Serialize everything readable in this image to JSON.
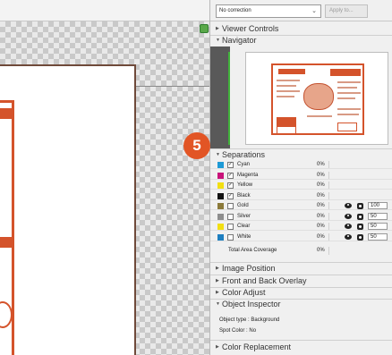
{
  "toolbar": {
    "correction_value": "No correction",
    "apply_label": "Apply to..."
  },
  "sections": {
    "viewer_controls": "Viewer Controls",
    "navigator": "Navigator",
    "separations": "Separations",
    "image_position": "Image Position",
    "front_back_overlay": "Front and Back Overlay",
    "color_adjust": "Color Adjust",
    "object_inspector": "Object Inspector",
    "color_replacement": "Color Replacement"
  },
  "marker": "5",
  "separations": [
    {
      "name": "Cyan",
      "pct": "0%",
      "checked": true,
      "color": "#1e9ad6",
      "value": null
    },
    {
      "name": "Magenta",
      "pct": "0%",
      "checked": true,
      "color": "#c8137a",
      "value": null
    },
    {
      "name": "Yellow",
      "pct": "0%",
      "checked": true,
      "color": "#f2df12",
      "value": null
    },
    {
      "name": "Black",
      "pct": "0%",
      "checked": true,
      "color": "#111111",
      "value": null
    },
    {
      "name": "Gold",
      "pct": "0%",
      "checked": false,
      "color": "#8b7a3a",
      "value": "100"
    },
    {
      "name": "Silver",
      "pct": "0%",
      "checked": false,
      "color": "#8e8e8e",
      "value": "50"
    },
    {
      "name": "Clear",
      "pct": "0%",
      "checked": false,
      "color": "#f2df12",
      "value": "50"
    },
    {
      "name": "White",
      "pct": "0%",
      "checked": false,
      "color": "#1e7fc0",
      "value": "50"
    }
  ],
  "total_coverage": {
    "label": "Total Area Coverage",
    "pct": "0%"
  },
  "object_inspector": {
    "object_type_label": "Object type :",
    "object_type_value": "Background",
    "spot_color_label": "Spot Color :",
    "spot_color_value": "No"
  },
  "icons": {
    "expand": "triangle-right-icon",
    "collapse": "triangle-down-icon",
    "eye": "eye-icon",
    "channel": "channel-dot-icon",
    "dropdown": "chevron-down-icon",
    "viewer_toggle": "green-viewer-icon"
  },
  "colors": {
    "accent_marker": "#e25525",
    "navigator_frame": "#41b23b"
  }
}
